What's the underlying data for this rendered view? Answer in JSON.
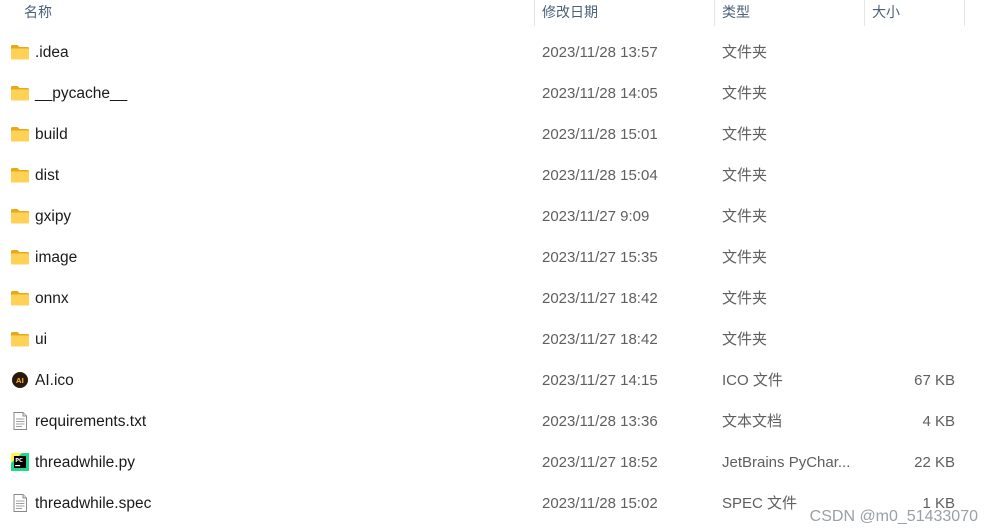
{
  "header": {
    "name": "名称",
    "modified": "修改日期",
    "type": "类型",
    "size": "大小"
  },
  "files": [
    {
      "name": ".idea",
      "date": "2023/11/28 13:57",
      "type": "文件夹",
      "size": "",
      "icon": "folder-icon"
    },
    {
      "name": "__pycache__",
      "date": "2023/11/28 14:05",
      "type": "文件夹",
      "size": "",
      "icon": "folder-icon"
    },
    {
      "name": "build",
      "date": "2023/11/28 15:01",
      "type": "文件夹",
      "size": "",
      "icon": "folder-icon"
    },
    {
      "name": "dist",
      "date": "2023/11/28 15:04",
      "type": "文件夹",
      "size": "",
      "icon": "folder-icon"
    },
    {
      "name": "gxipy",
      "date": "2023/11/27 9:09",
      "type": "文件夹",
      "size": "",
      "icon": "folder-icon"
    },
    {
      "name": "image",
      "date": "2023/11/27 15:35",
      "type": "文件夹",
      "size": "",
      "icon": "folder-icon"
    },
    {
      "name": "onnx",
      "date": "2023/11/27 18:42",
      "type": "文件夹",
      "size": "",
      "icon": "folder-icon"
    },
    {
      "name": "ui",
      "date": "2023/11/27 18:42",
      "type": "文件夹",
      "size": "",
      "icon": "folder-icon"
    },
    {
      "name": "AI.ico",
      "date": "2023/11/27 14:15",
      "type": "ICO 文件",
      "size": "67 KB",
      "icon": "ai-logo-icon"
    },
    {
      "name": "requirements.txt",
      "date": "2023/11/28 13:36",
      "type": "文本文档",
      "size": "4 KB",
      "icon": "text-document-icon"
    },
    {
      "name": "threadwhile.py",
      "date": "2023/11/27 18:52",
      "type": "JetBrains PyChar...",
      "size": "22 KB",
      "icon": "pycharm-icon"
    },
    {
      "name": "threadwhile.spec",
      "date": "2023/11/28 15:02",
      "type": "SPEC 文件",
      "size": "1 KB",
      "icon": "text-document-icon"
    }
  ],
  "watermark": "CSDN @m0_51433070"
}
